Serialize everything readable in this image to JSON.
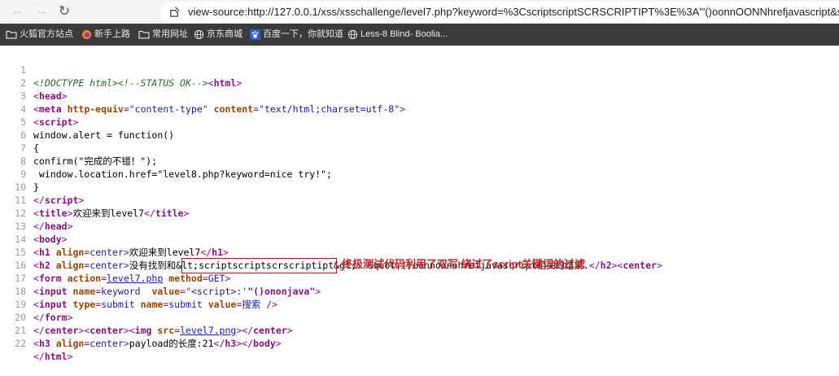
{
  "browser": {
    "url": "view-source:http://127.0.0.1/xss/xsschallenge/level7.php?keyword=%3CscriptscriptSCRSCRIPTIPT%3E%3A'\"()oonnOONNhrefjavascript&subm",
    "bookmarks": [
      {
        "icon": "folder-icon",
        "label": "火狐官方站点"
      },
      {
        "icon": "firefox-icon",
        "label": "新手上路"
      },
      {
        "icon": "folder-icon",
        "label": "常用网址"
      },
      {
        "icon": "globe-icon",
        "label": "京东商城"
      },
      {
        "icon": "baidu-paw-icon",
        "label": "百度一下，你就知道"
      },
      {
        "icon": "globe-icon",
        "label": "Less-8 Blind- Boolia..."
      }
    ]
  },
  "source": {
    "line_numbers": [
      "1",
      "2",
      "3",
      "4",
      "5",
      "6",
      "7",
      "8",
      "9",
      "10",
      "11",
      "12",
      "13",
      "14",
      "15",
      "16",
      "17",
      "18",
      "19",
      "20",
      "21",
      "22"
    ],
    "lines": {
      "l1": [
        "<!DOCTYPE html>",
        "<!--STATUS OK-->",
        "<",
        "html",
        ">"
      ],
      "l2": [
        "<",
        "head",
        ">"
      ],
      "l3": [
        "<",
        "meta ",
        "http-equiv",
        "=\"",
        "content-type",
        "\" ",
        "content",
        "=\"",
        "text/html;charset=utf-8",
        "\">"
      ],
      "l4": [
        "<",
        "script",
        ">"
      ],
      "l5": [
        "window.alert = function()"
      ],
      "l6": [
        "{"
      ],
      "l7": [
        "confirm(\"完成的不错！\");"
      ],
      "l8": [
        " window.location.href=\"level8.php?keyword=nice try!\";"
      ],
      "l9": [
        "}"
      ],
      "l10": [
        "</",
        "script",
        ">"
      ],
      "l11": [
        "<",
        "title",
        ">",
        "欢迎来到level7",
        "</",
        "title",
        ">"
      ],
      "l12": [
        "</",
        "head",
        ">"
      ],
      "l13": [
        "<",
        "body",
        ">"
      ],
      "l14": [
        "<",
        "h1 ",
        "align",
        "=",
        "center",
        ">",
        "欢迎来到level7",
        "</",
        "h1",
        ">"
      ],
      "l15": [
        "<",
        "h2 ",
        "align",
        "=",
        "center",
        ">",
        "没有找到和&lt;scriptscriptscrscriptipt&gt;:'&quot;()oonnoonnhrefjavascript相关的结果.",
        "</",
        "h2",
        "><",
        "center",
        ">"
      ],
      "l16": [
        "<",
        "form ",
        "action",
        "=",
        "level7.php",
        " ",
        "method",
        "=",
        "GET",
        ">"
      ],
      "l17": [
        "<",
        "input ",
        "name",
        "=",
        "keyword",
        "  ",
        "value",
        "=\"",
        "<script>",
        ":'",
        "\"()ononjava\"",
        ">"
      ],
      "l18": [
        "<",
        "input ",
        "type",
        "=",
        "submit",
        " ",
        "name",
        "=",
        "submit",
        " ",
        "value",
        "=",
        "搜索",
        " />"
      ],
      "l19": [
        "</",
        "form",
        ">"
      ],
      "l20": [
        "</",
        "center",
        "><",
        "center",
        "><",
        "img ",
        "src",
        "=",
        "level7.png",
        "></",
        "center",
        ">"
      ],
      "l21": [
        "<",
        "h3 ",
        "align",
        "=",
        "center",
        ">",
        "payload的长度:21",
        "</",
        "h3",
        "></",
        "body",
        ">"
      ],
      "l22": [
        "</",
        "html",
        ">"
      ]
    }
  },
  "annotation": {
    "text": "终极测试代码利用了双写 绕过了script关键词的过滤"
  }
}
